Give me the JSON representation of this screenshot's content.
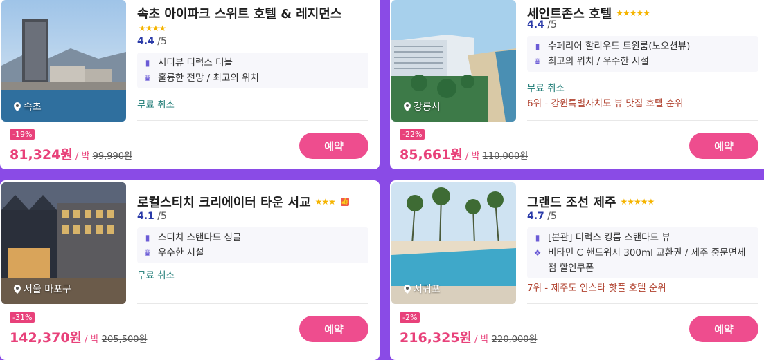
{
  "hotels": [
    {
      "name": "속초 아이파크 스위트 호텔 & 레지던스",
      "stars": "★★★★",
      "rating": "4.4",
      "rating_out": " /5",
      "feature1": "시티뷰 디럭스 더블",
      "feature2": "훌륭한 전망 / 최고의 위치",
      "cancel": "무료 취소",
      "location": "속초",
      "discount": "-19%",
      "price": "81,324원",
      "unit": " / 박 ",
      "original": "99,990원",
      "book": "예약"
    },
    {
      "name": "세인트존스 호텔",
      "stars": "★★★★★",
      "rating": "4.4",
      "rating_out": " /5",
      "feature1": "수페리어 할리우드 트윈룸(노오션뷰)",
      "feature2": "최고의 위치 / 우수한 시설",
      "cancel": "무료 취소",
      "rank": "6위 - 강원특별자치도 뷰 맛집 호텔 순위",
      "location": "강릉시",
      "discount": "-22%",
      "price": "85,661원",
      "unit": " / 박 ",
      "original": "110,000원",
      "book": "예약"
    },
    {
      "name": "로컬스티치 크리에이터 타운 서교",
      "stars": "★★★",
      "thumb": "👍",
      "rating": "4.1",
      "rating_out": " /5",
      "feature1": "스티치 스탠다드 싱글",
      "feature2": "우수한 시설",
      "cancel": "무료 취소",
      "location": "서울 마포구",
      "discount": "-31%",
      "price": "142,370원",
      "unit": " / 박 ",
      "original": "205,500원",
      "book": "예약"
    },
    {
      "name": "그랜드 조선 제주",
      "stars": "★★★★★",
      "rating": "4.7",
      "rating_out": " /5",
      "feature1": "[본관] 디럭스 킹룸 스탠다드 뷰",
      "feature2": "비타민 C 핸드워시 300ml 교환권 / 제주 중문면세점 할인쿠폰",
      "rank": "7위 - 제주도 인스타 핫플 호텔 순위",
      "location": "서귀포",
      "discount": "-2%",
      "price": "216,325원",
      "unit": " / 박 ",
      "original": "220,000원",
      "book": "예약"
    }
  ]
}
